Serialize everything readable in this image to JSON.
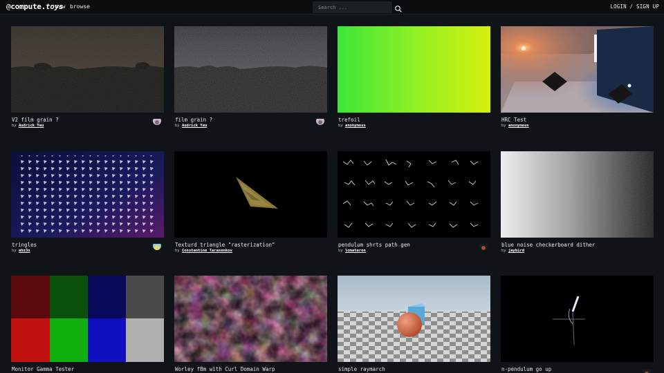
{
  "header": {
    "logo_prefix": "@",
    "logo_main": "compute.",
    "logo_suffix": "toys",
    "nav_new": "new",
    "nav_browse": "browse",
    "search_placeholder": "Search ...",
    "login": "LOGIN / SIGN UP"
  },
  "by_label": "by",
  "shaders": [
    {
      "title": "V2 film grain ?",
      "author": "Audrick Yeu",
      "thumb": "night-landscape-grain"
    },
    {
      "title": "film grain ?",
      "author": "Audrick Yeu",
      "thumb": "night-landscape-heavy-grain"
    },
    {
      "title": "trefoil",
      "author": "anonymous",
      "thumb": "green-yellow-gradient"
    },
    {
      "title": "HRC Test",
      "author": "anonymous",
      "thumb": "lit-room"
    },
    {
      "title": "tringles",
      "author": "ahz3n",
      "thumb": "triangle-grid"
    },
    {
      "title": "Texturd triangle \"rasterization\"",
      "author": "Constantine Tarasenkov",
      "thumb": "textured-triangle"
    },
    {
      "title": "pendulum shrts path gen",
      "author": "lomateron",
      "thumb": "pendulum-paths"
    },
    {
      "title": "blue noise checkerboard dither",
      "author": "jaybird",
      "thumb": "dither-gradient"
    },
    {
      "title": "Monitor Gamma Tester",
      "author": "",
      "thumb": "gamma-bars"
    },
    {
      "title": "Worley fBm with Curl Domain Warp",
      "author": "",
      "thumb": "worley-fbm"
    },
    {
      "title": "simple raymarch",
      "author": "",
      "thumb": "raymarch-scene"
    },
    {
      "title": "n-pendulum go up",
      "author": "",
      "thumb": "n-pendulum"
    }
  ],
  "colors": {
    "background": "#101418",
    "topbar": "#0b0e11",
    "text": "#e3e7eb"
  }
}
